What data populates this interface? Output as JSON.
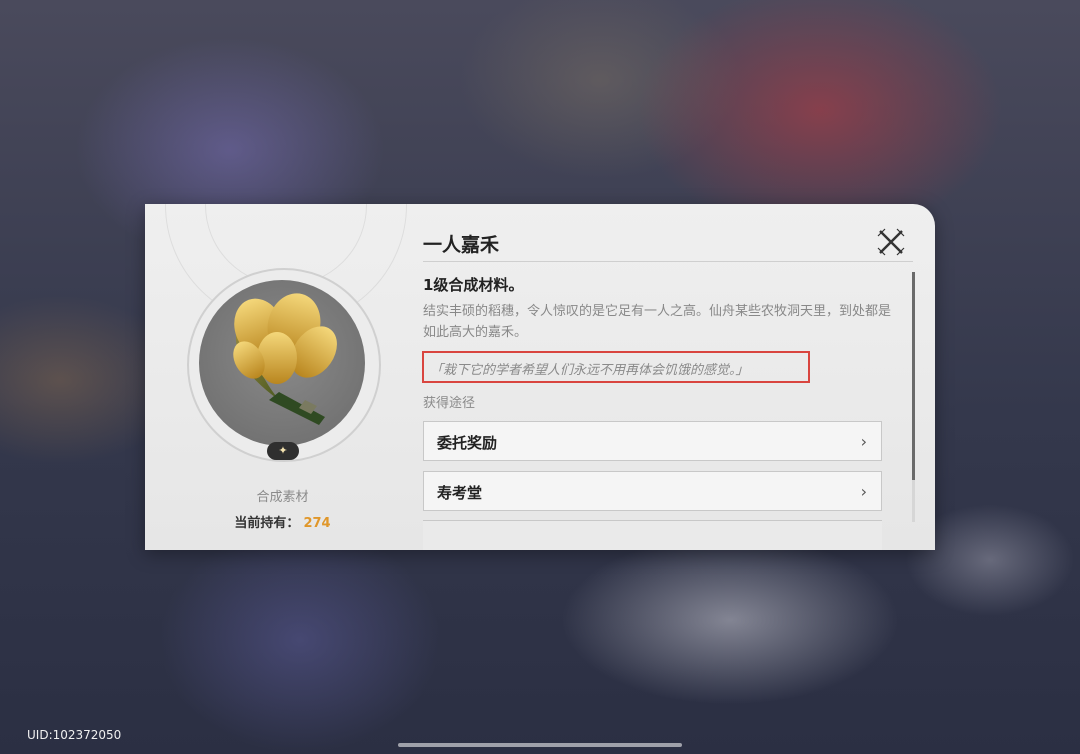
{
  "item": {
    "name": "一人嘉禾",
    "level_type": "1级合成材料。",
    "description": "结实丰硕的稻穗，令人惊叹的是它足有一人之高。仙舟某些农牧洞天里，到处都是如此高大的嘉禾。",
    "quote": "「栽下它的学者希望人们永远不用再体会饥饿的感觉。」",
    "category": "合成素材",
    "owned_label": "当前持有：",
    "owned_count": "274",
    "rarity_symbol": "✦",
    "icon": "golden-rice-grain-icon"
  },
  "obtain": {
    "heading": "获得途径",
    "sources": [
      {
        "label": "委托奖励"
      },
      {
        "label": "寿考堂"
      }
    ]
  },
  "footer": {
    "uid": "UID:102372050"
  },
  "colors": {
    "highlight_border": "#d9453f",
    "owned_count": "#e0972a"
  },
  "scroll_position_fraction": 0.0
}
